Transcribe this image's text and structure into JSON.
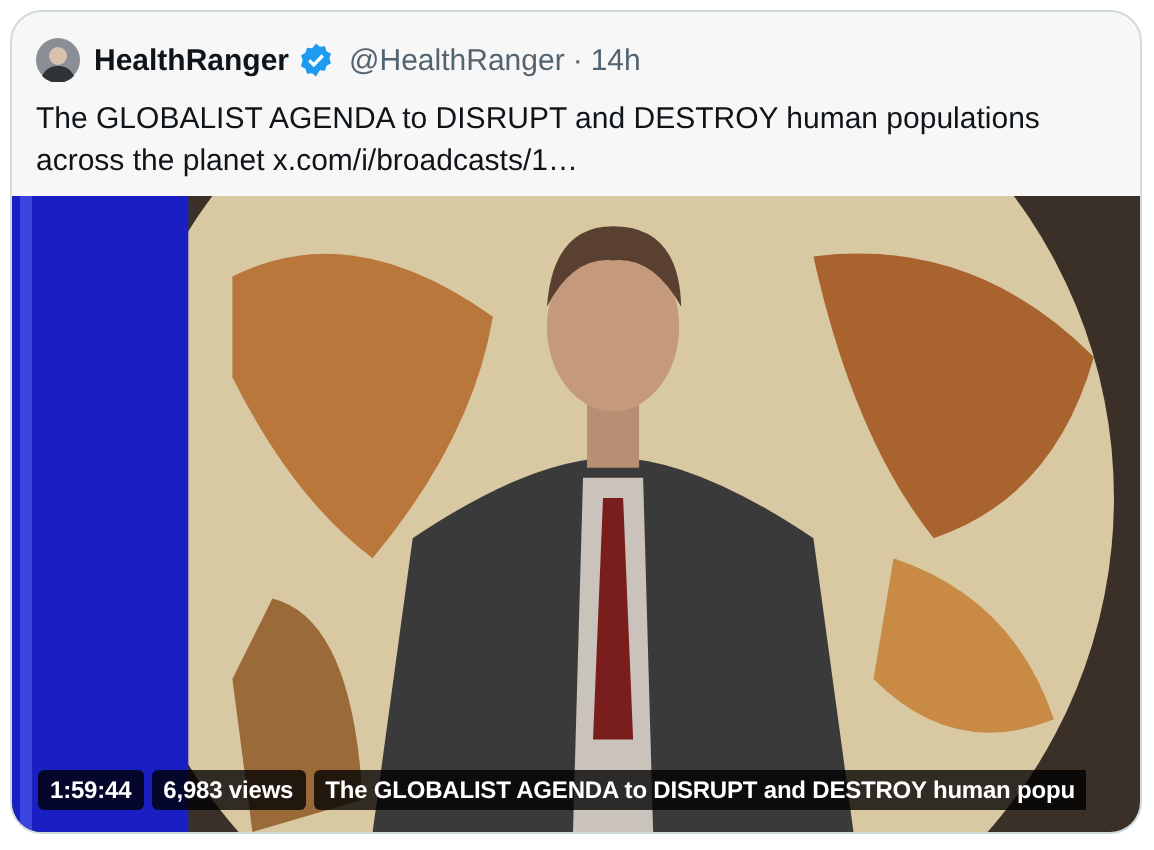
{
  "post": {
    "author": "HealthRanger",
    "verified": true,
    "handle": "@HealthRanger",
    "separator": "·",
    "time": "14h",
    "text": "The GLOBALIST AGENDA to DISRUPT and DESTROY human populations across the planet x.com/i/broadcasts/1…"
  },
  "video": {
    "kind": "picture",
    "duration": "1:59:44",
    "views": "6,983 views",
    "title": "The GLOBALIST AGENDA to DISRUPT and DESTROY human popu"
  }
}
